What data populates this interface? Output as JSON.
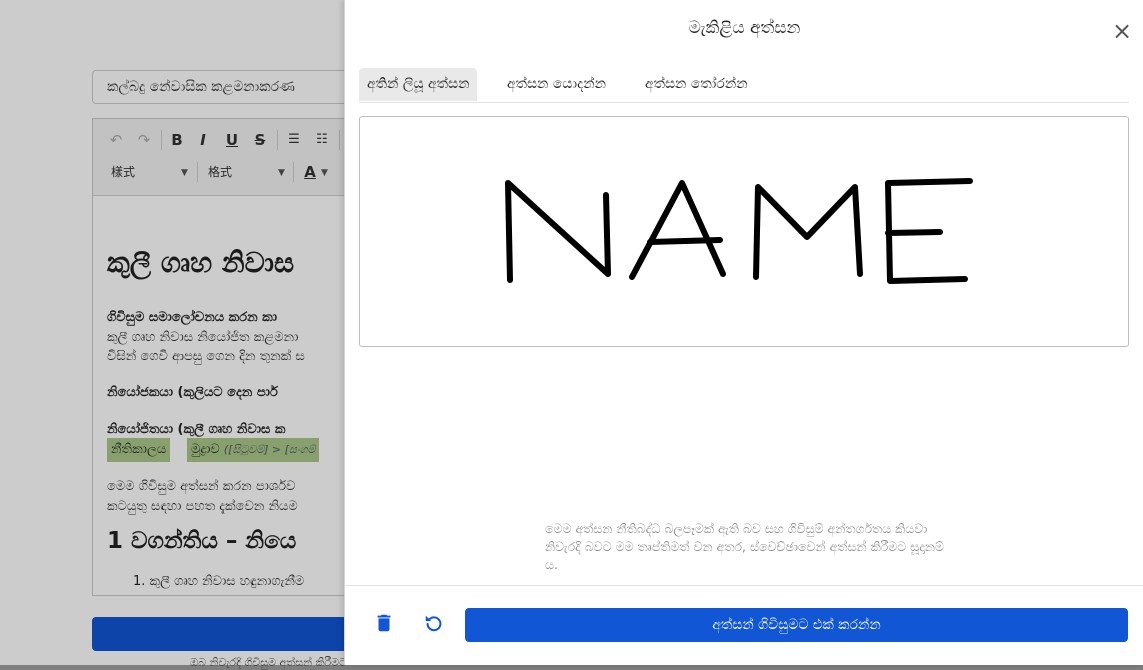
{
  "background": {
    "title_input_value": "කල්බදු නේවාසික කළමනාකරණ",
    "toolbar": {
      "style_label": "樣式",
      "format_label": "格式",
      "bold": "B",
      "italic": "I",
      "underline": "U",
      "strike": "S",
      "font_color": "A"
    },
    "document": {
      "heading": "කුලී ගෘහ නිවාස",
      "para1_bold": "ගිවිසුම සමාලෝචනය කරන කා",
      "para1_line2": "කුලී ගෘහ නිවාස නියෝජිත කළමනා",
      "para1_line3": "විසින් ගෙවී ආපසු ගෙන දින තුනක් ස",
      "para2_bold": "නියෝජකයා (කුලියට දෙන පාර්",
      "para3_bold": "නියෝජිතයා (කුලී ගෘහ නිවාස ක",
      "chip1": "නීතිකාලය",
      "chip2_text": "මුද්‍රාව",
      "chip2_small": "([සිටුවම්] > [සංගම්",
      "para4_line1": "මෙම ගිවිසුම අත්සන් කරන පාර්ශව",
      "para4_line2": "කටයුතු සඳහා පහත දැක්වෙන නියම",
      "heading2": "1 වගන්තිය – නියෙ",
      "list_item1": "1. කුලී ගෘහ නිවාස හඳුනාගැනීම"
    },
    "below_text": "ඔබ නිවැරදි ගිවිසුම අත්සන් කිරීමට"
  },
  "panel": {
    "title": "මැකිළිය අත්සන",
    "close_symbol": "×",
    "tabs": [
      {
        "label": "අතින් ලියූ අත්සන",
        "active": true
      },
      {
        "label": "අත්සන යොදන්න",
        "active": false
      },
      {
        "label": "අත්සන තෝරන්න",
        "active": false
      }
    ],
    "disclaimer": "මෙම අත්සන නීතිබද්ධ බලපෑමක් ඇති බව සහ ගිවිසුම් අන්තර්ගතය කියවා නිවැරදි බවට මම තෘප්තිමත් වන අතර, ස්වෙච්ඡාවෙන් අත්සන් කිරීමට සූදානම් ය.",
    "submit_label": "අත්සන් ගිවිසුමට එක් කරන්න",
    "icons": {
      "delete": "trash-icon",
      "undo": "undo-icon",
      "close": "close-icon"
    }
  },
  "colors": {
    "primary": "#1156d4",
    "chip_bg": "#a9c98a"
  }
}
